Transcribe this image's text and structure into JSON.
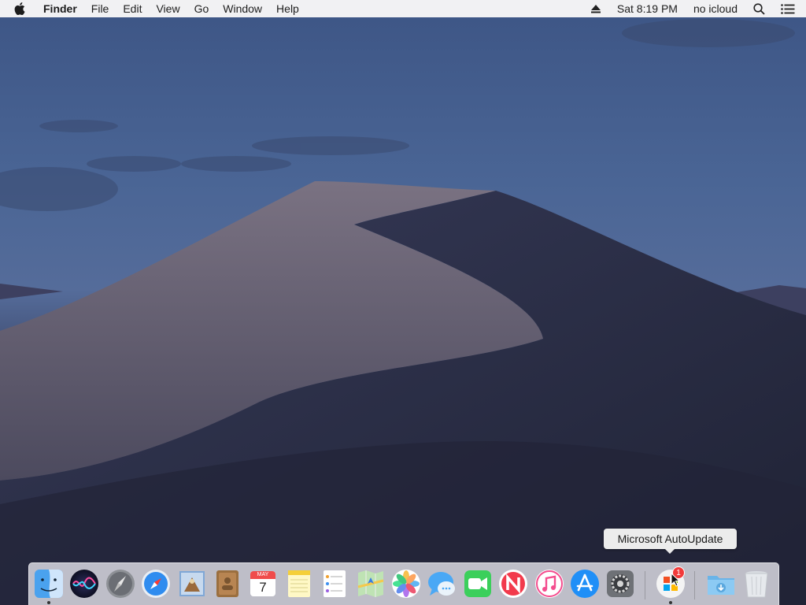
{
  "menubar": {
    "app_name": "Finder",
    "menus": [
      "File",
      "Edit",
      "View",
      "Go",
      "Window",
      "Help"
    ],
    "clock": "Sat 8:19 PM",
    "user": "no icloud",
    "icons": [
      "apple-logo",
      "eject-icon",
      "spotlight-search-icon",
      "notification-center-icon"
    ]
  },
  "desktop": {
    "wallpaper": "mojave-dunes-dusk",
    "colors": {
      "sky_top": "#3d5585",
      "sky_horizon": "#556c9a",
      "dune_light": "#6e6878",
      "dune_dark": "#262a40"
    }
  },
  "tooltip": {
    "text": "Microsoft AutoUpdate"
  },
  "dock": {
    "apps": [
      {
        "name": "Finder",
        "running": true
      },
      {
        "name": "Siri",
        "running": false
      },
      {
        "name": "Launchpad",
        "running": false
      },
      {
        "name": "Safari",
        "running": false
      },
      {
        "name": "Mail",
        "running": false
      },
      {
        "name": "Contacts",
        "running": false
      },
      {
        "name": "Calendar",
        "running": false,
        "month": "MAY",
        "day": "7"
      },
      {
        "name": "Notes",
        "running": false
      },
      {
        "name": "Reminders",
        "running": false
      },
      {
        "name": "Maps",
        "running": false
      },
      {
        "name": "Photos",
        "running": false
      },
      {
        "name": "Messages",
        "running": false
      },
      {
        "name": "FaceTime",
        "running": false
      },
      {
        "name": "News",
        "running": false
      },
      {
        "name": "iTunes",
        "running": false
      },
      {
        "name": "App Store",
        "running": false
      },
      {
        "name": "System Preferences",
        "running": false
      },
      {
        "name": "Microsoft AutoUpdate",
        "running": true,
        "badge": "1"
      }
    ],
    "stacks": [
      {
        "name": "Downloads"
      },
      {
        "name": "Trash"
      }
    ]
  }
}
